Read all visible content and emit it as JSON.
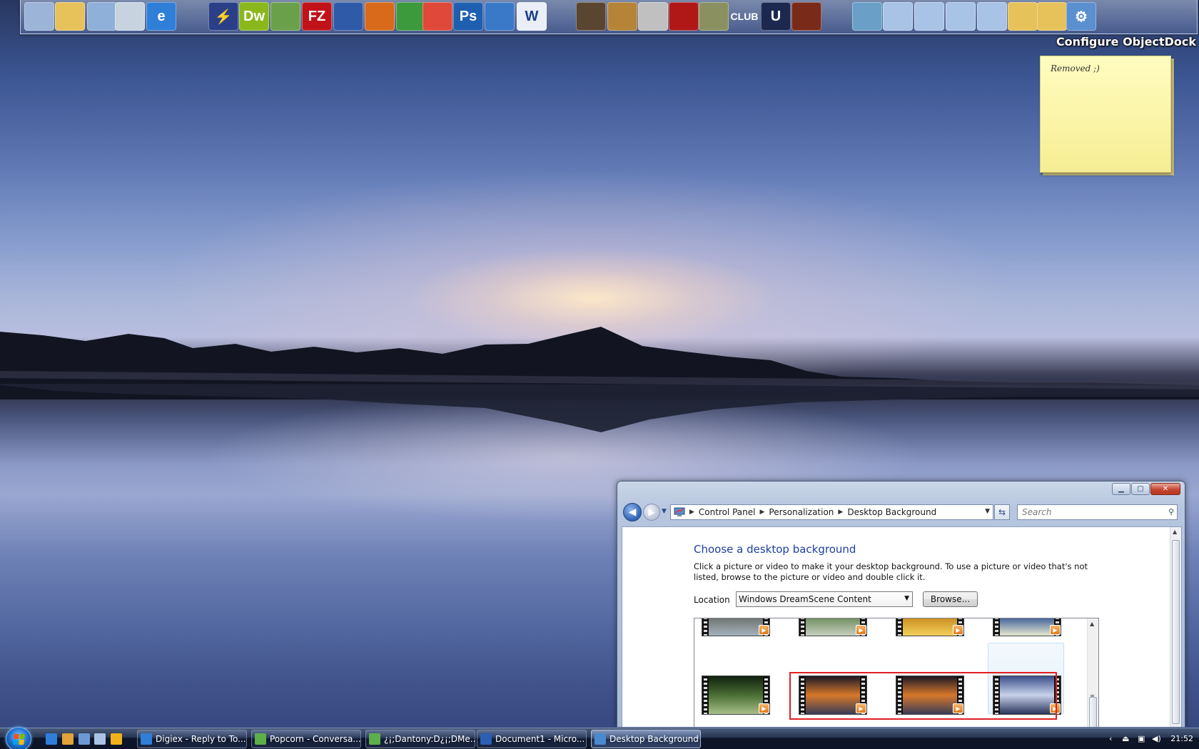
{
  "dock": {
    "label": "Configure ObjectDock",
    "items": [
      {
        "name": "computer-icon",
        "glyph": "",
        "bg": "#9bb4d8"
      },
      {
        "name": "documents-folder-icon",
        "glyph": "",
        "bg": "#e7c25a"
      },
      {
        "name": "network-icon",
        "glyph": "",
        "bg": "#8fb0d8"
      },
      {
        "name": "recycle-bin-icon",
        "glyph": "",
        "bg": "#c8d3e0"
      },
      {
        "name": "internet-explorer-icon",
        "glyph": "e",
        "bg": "#2f7fd8"
      },
      {
        "name": "daemon-tools-icon",
        "glyph": "⚡",
        "bg": "#2a3f88"
      },
      {
        "name": "dreamweaver-icon",
        "glyph": "Dw",
        "bg": "#8ab81c"
      },
      {
        "name": "feeds-reader-icon",
        "glyph": "",
        "bg": "#6aa04a"
      },
      {
        "name": "filezilla-icon",
        "glyph": "FZ",
        "bg": "#c1121a"
      },
      {
        "name": "google-earth-icon",
        "glyph": "",
        "bg": "#2e5aa8"
      },
      {
        "name": "media-burner-icon",
        "glyph": "",
        "bg": "#d96a1b"
      },
      {
        "name": "windows-flag-icon",
        "glyph": "",
        "bg": "#3c9a3c"
      },
      {
        "name": "nero-burn-icon",
        "glyph": "",
        "bg": "#e0483a"
      },
      {
        "name": "photoshop-icon",
        "glyph": "Ps",
        "bg": "#1e5fb0"
      },
      {
        "name": "clone-cd-icon",
        "glyph": "",
        "bg": "#3a78c8"
      },
      {
        "name": "word-icon",
        "glyph": "W",
        "bg": "#e9eef7"
      },
      {
        "name": "samurai-game-icon",
        "glyph": "",
        "bg": "#5a4530"
      },
      {
        "name": "age-of-empires-icon",
        "glyph": "",
        "bg": "#b58438"
      },
      {
        "name": "mascot-game-icon",
        "glyph": "",
        "bg": "#c0c0c0"
      },
      {
        "name": "gears-of-war-icon",
        "glyph": "",
        "bg": "#b01818"
      },
      {
        "name": "devil-may-cry-icon",
        "glyph": "",
        "bg": "#8a9060"
      },
      {
        "name": "the-club-icon",
        "glyph": "CLUB",
        "bg": "transparent"
      },
      {
        "name": "unreal-tournament-icon",
        "glyph": "U",
        "bg": "#1c2850"
      },
      {
        "name": "medal-of-honor-icon",
        "glyph": "",
        "bg": "#7a2a18"
      },
      {
        "name": "downloads-icon",
        "glyph": "",
        "bg": "#6aa0c8"
      },
      {
        "name": "computer-shortcut-1-icon",
        "glyph": "",
        "bg": "#a9c3e6"
      },
      {
        "name": "computer-shortcut-2-icon",
        "glyph": "",
        "bg": "#a9c3e6"
      },
      {
        "name": "computer-shortcut-3-icon",
        "glyph": "",
        "bg": "#a9c3e6"
      },
      {
        "name": "computer-shortcut-4-icon",
        "glyph": "",
        "bg": "#a9c3e6"
      },
      {
        "name": "folder-1-icon",
        "glyph": "",
        "bg": "#e7c25a"
      },
      {
        "name": "folder-2-icon",
        "glyph": "",
        "bg": "#e7c25a"
      },
      {
        "name": "settings-gears-icon",
        "glyph": "⚙",
        "bg": "#5a8fd0"
      }
    ]
  },
  "sticky_note": {
    "text": "Removed ;)"
  },
  "window": {
    "breadcrumb": [
      "Control Panel",
      "Personalization",
      "Desktop Background"
    ],
    "search_placeholder": "Search",
    "heading": "Choose a desktop background",
    "description": "Click a picture or video to make it your desktop background. To use a picture or video that's not listed, browse to the picture or video and double click it.",
    "location_label": "Location",
    "location_value": "Windows DreamScene Content",
    "browse_label": "Browse...",
    "videos_row1": [
      {
        "name": "video-mountain-road",
        "colors": [
          "#2b2e32",
          "#6b6f6a",
          "#a6b3bd"
        ]
      },
      {
        "name": "video-waterfall",
        "colors": [
          "#1f3a22",
          "#6b8a5a",
          "#c7cfc0"
        ]
      },
      {
        "name": "video-fire-lights",
        "colors": [
          "#2a1a06",
          "#c88a1e",
          "#f2cf58"
        ]
      },
      {
        "name": "video-planet",
        "colors": [
          "#0f1f3f",
          "#3a5a96",
          "#e6e8d0"
        ]
      }
    ],
    "videos_row2": [
      {
        "name": "video-forest-stream",
        "colors": [
          "#10200e",
          "#4a6e34",
          "#a8c08a"
        ]
      },
      {
        "name": "video-sunset-lake-1",
        "colors": [
          "#1a1826",
          "#d8782a",
          "#3a3c58"
        ]
      },
      {
        "name": "video-sunset-lake-2",
        "colors": [
          "#1a1826",
          "#d8782a",
          "#3a3c58"
        ]
      },
      {
        "name": "video-blue-lake",
        "colors": [
          "#3a4f8a",
          "#c8d2ea",
          "#2a335a"
        ]
      }
    ]
  },
  "taskbar": {
    "quick_launch": [
      {
        "name": "quicklaunch-ie-icon",
        "color": "#2f7fd8"
      },
      {
        "name": "quicklaunch-thunderbird-icon",
        "color": "#e1a33a"
      },
      {
        "name": "quicklaunch-show-desktop-icon",
        "color": "#6d9ad6"
      },
      {
        "name": "quicklaunch-switch-windows-icon",
        "color": "#a9c3e6"
      },
      {
        "name": "quicklaunch-media-player-icon",
        "color": "#f0b21a"
      }
    ],
    "buttons": [
      {
        "name": "task-digiex",
        "label": "Digiex - Reply to To...",
        "color": "#2f7fd8",
        "active": false
      },
      {
        "name": "task-popcorn",
        "label": "Popcorn - Conversa...",
        "color": "#5cb04a",
        "active": false
      },
      {
        "name": "task-dantony",
        "label": "¿¡;Dantony:D¿¡;DMe...",
        "color": "#5cb04a",
        "active": false
      },
      {
        "name": "task-document1",
        "label": "Document1 - Micro...",
        "color": "#2b5fb4",
        "active": false
      },
      {
        "name": "task-desktop-background",
        "label": "Desktop Background",
        "color": "#4a8ad0",
        "active": true
      }
    ],
    "clock": "21:52"
  }
}
